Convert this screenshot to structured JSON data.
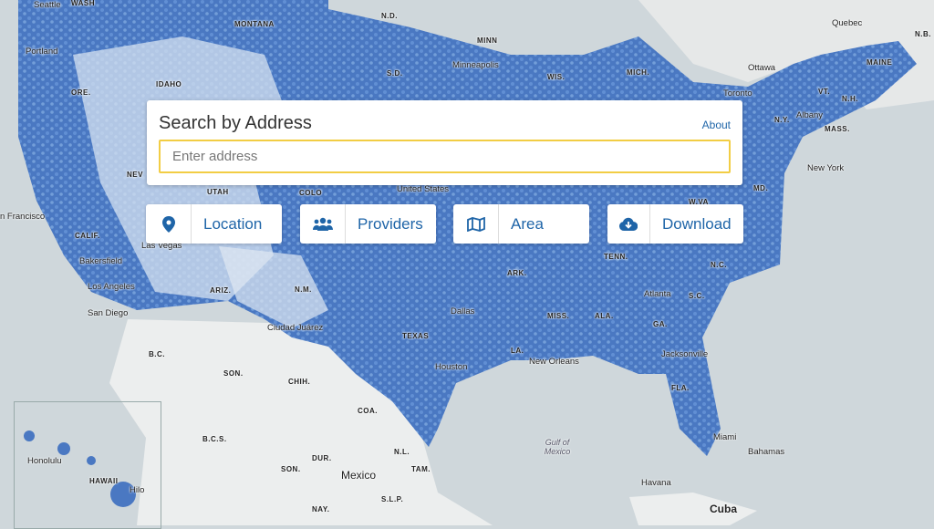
{
  "search": {
    "title": "Search by Address",
    "about_label": "About",
    "placeholder": "Enter address",
    "value": ""
  },
  "buttons": [
    {
      "label": "Location",
      "icon": "map-marker-icon"
    },
    {
      "label": "Providers",
      "icon": "users-icon"
    },
    {
      "label": "Area",
      "icon": "map-icon"
    },
    {
      "label": "Download",
      "icon": "cloud-download-icon"
    }
  ],
  "colors": {
    "accent": "#1f65a8",
    "coverage_high": "#4a78c2",
    "coverage_mid": "#7fb0e6",
    "coverage_low": "#c8dcf2",
    "input_border": "#f2cd44"
  },
  "map_labels": {
    "seattle": "Seattle",
    "wash": "WASH",
    "montana": "MONTANA",
    "nd": "N.D.",
    "minn": "MINN",
    "quebec": "Quebec",
    "nb": "N.B.",
    "ottawa": "Ottawa",
    "maine": "MAINE",
    "portland": "Portland",
    "ore": "ORE.",
    "idaho": "IDAHO",
    "sd": "S.D.",
    "minneapolis": "Minneapolis",
    "wis": "WIS.",
    "mich": "MICH.",
    "toronto": "Toronto",
    "vt": "VT.",
    "nh": "N.H.",
    "albany": "Albany",
    "ny": "N.Y.",
    "mass": "MASS.",
    "newyork": "New York",
    "nev": "NEV",
    "utah": "UTAH",
    "colo": "COLO",
    "us": "United States",
    "wva": "W.VA",
    "md": "MD.",
    "sf": "n Francisco",
    "calif": "CALIF.",
    "lasvegas": "Las Vegas",
    "bakersfield": "Bakersfield",
    "la": "Los Angeles",
    "sandiego": "San Diego",
    "ariz": "ARIZ.",
    "nm": "N.M.",
    "juarez": "Ciudad Juárez",
    "texas": "TEXAS",
    "dallas": "Dallas",
    "ark": "ARK.",
    "tenn": "TENN.",
    "nc": "N.C.",
    "atlanta": "Atlanta",
    "sc": "S.C.",
    "miss": "MISS.",
    "ala": "ALA.",
    "ga": "GA.",
    "jacksonville": "Jacksonville",
    "lou": "LA.",
    "houston": "Houston",
    "neworleans": "New Orleans",
    "fla": "FLA.",
    "miami": "Miami",
    "bahamas": "Bahamas",
    "bc": "B.C.",
    "son": "SON.",
    "chih": "CHIH.",
    "coa": "COA.",
    "bcs": "B.C.S.",
    "dur": "DUR.",
    "nl": "N.L.",
    "tam": "TAM.",
    "mexico": "Mexico",
    "slp": "S.L.P.",
    "nay": "NAY.",
    "gulf": "Gulf of Mexico",
    "havana": "Havana",
    "cuba": "Cuba",
    "honolulu": "Honolulu",
    "hawaii": "HAWAII",
    "hilo": "Hilo"
  }
}
